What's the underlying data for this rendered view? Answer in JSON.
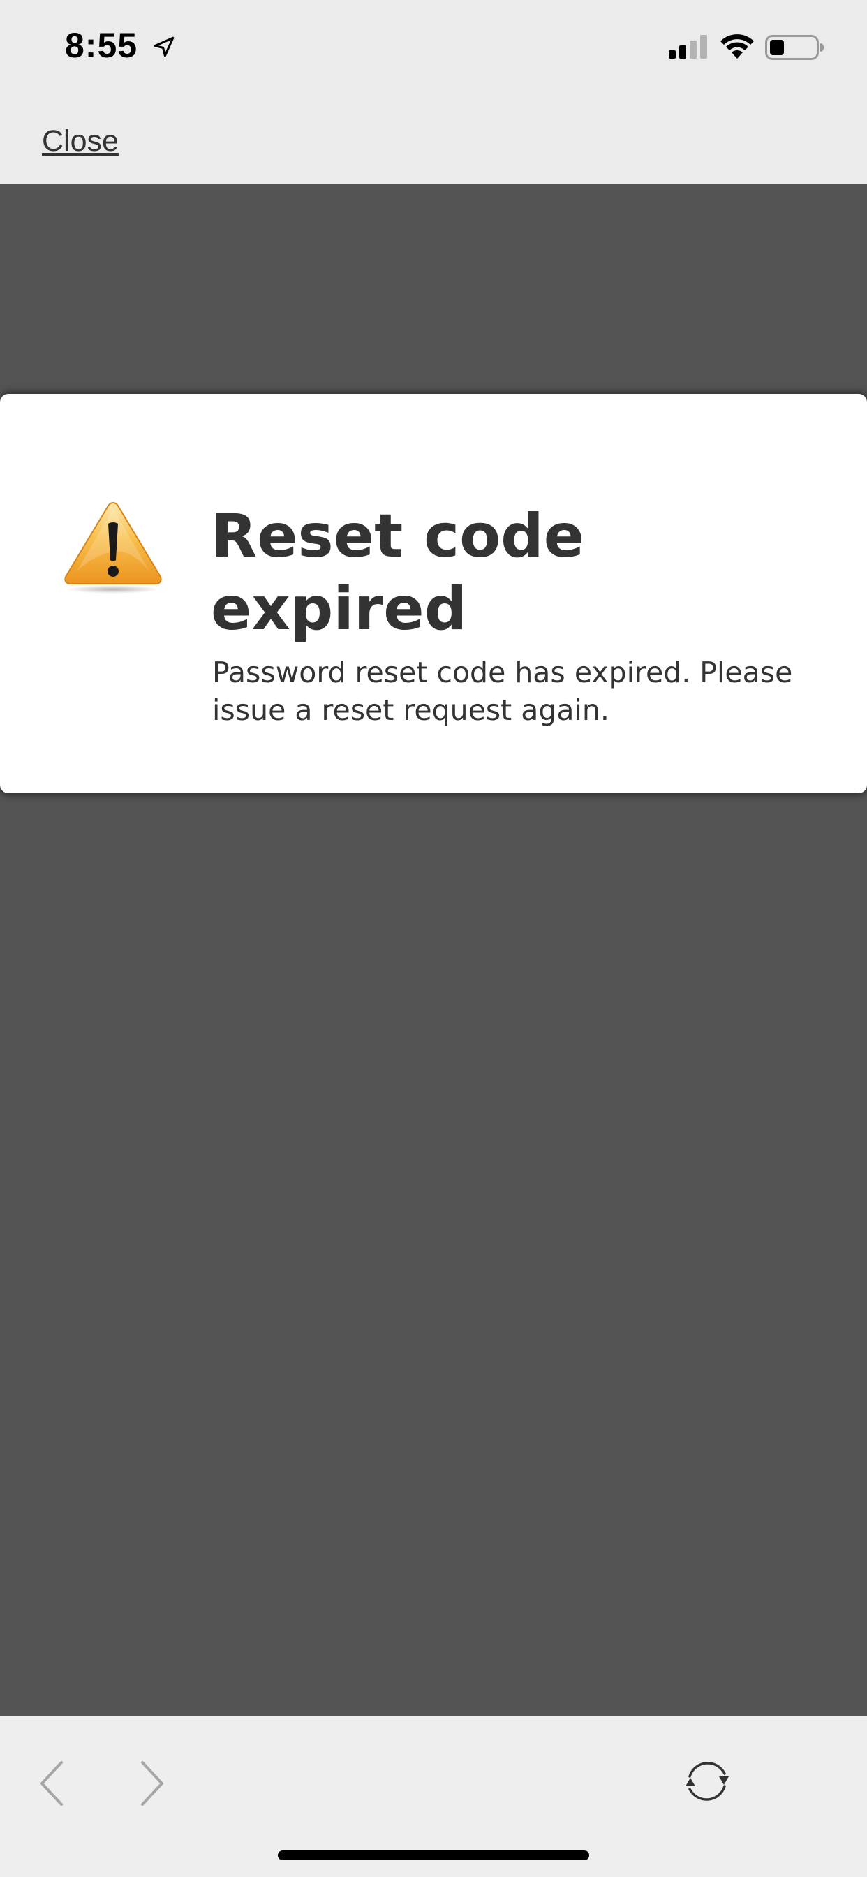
{
  "status_bar": {
    "time": "8:55",
    "icons": [
      "location-arrow-icon",
      "cellular-signal-icon",
      "wifi-icon",
      "battery-icon"
    ]
  },
  "nav": {
    "close_label": "Close"
  },
  "alert": {
    "icon": "warning-icon",
    "title": "Reset code expired",
    "message": "Password reset code has expired. Please issue a reset request again."
  },
  "toolbar": {
    "icons": [
      "back-chevron-icon",
      "forward-chevron-icon",
      "refresh-icon"
    ]
  },
  "colors": {
    "backdrop": "#545454",
    "bar_background": "#ebebeb",
    "card_background": "#ffffff",
    "text": "#333333",
    "warning": "#f3a52c"
  }
}
